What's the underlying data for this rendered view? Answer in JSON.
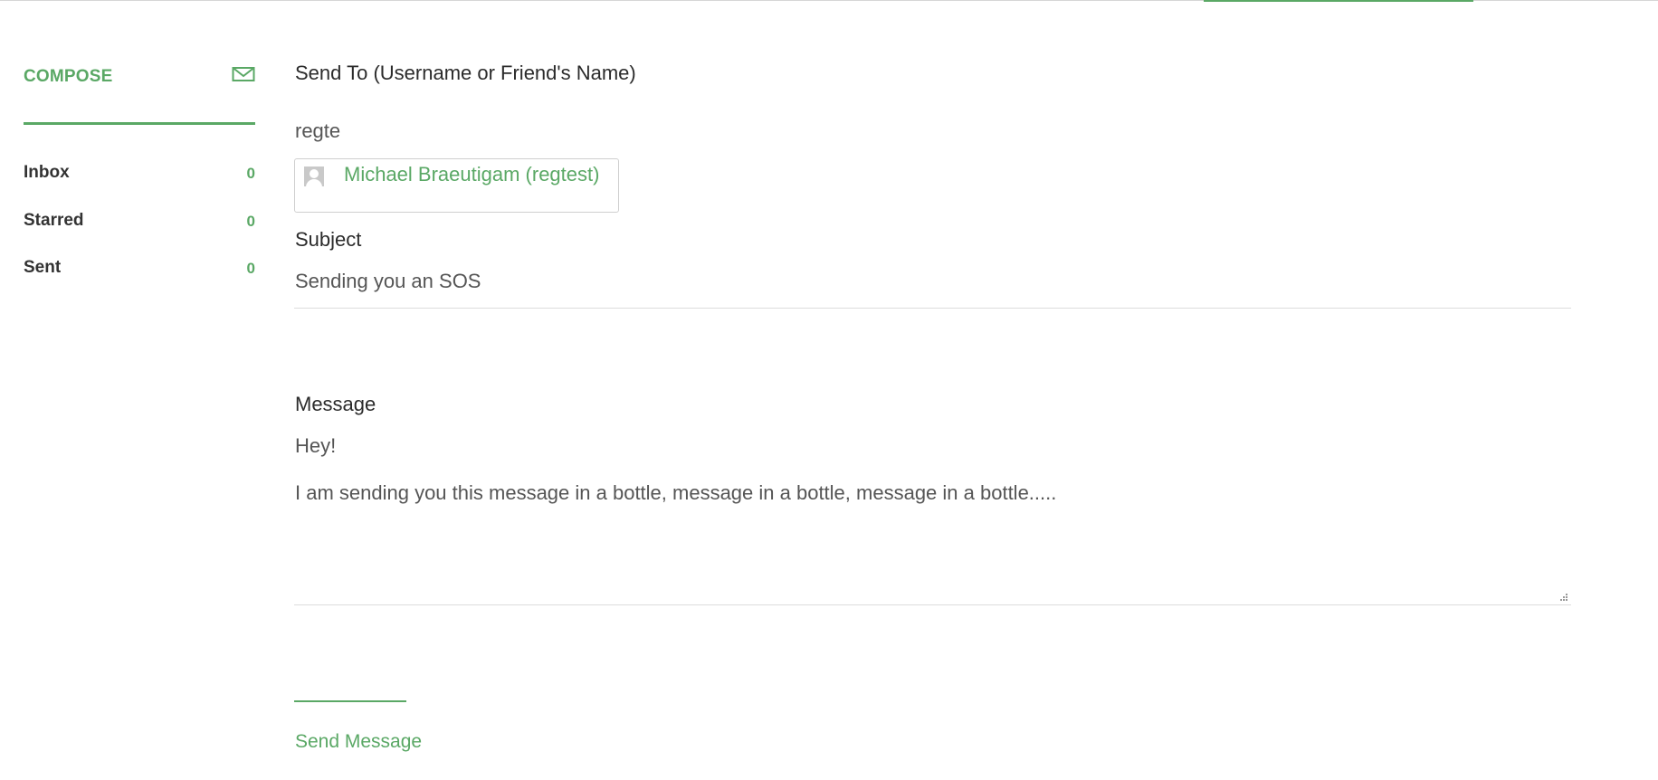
{
  "sidebar": {
    "compose_label": "COMPOSE",
    "compose_icon": "envelope-icon",
    "items": [
      {
        "label": "Inbox",
        "count": "0"
      },
      {
        "label": "Starred",
        "count": "0"
      },
      {
        "label": "Sent",
        "count": "0"
      }
    ]
  },
  "form": {
    "send_to_label": "Send To (Username or Friend's Name)",
    "send_to_value": "regte",
    "suggestion": {
      "avatar_icon": "user-avatar-icon",
      "text": "Michael Braeutigam (regtest)"
    },
    "subject_label": "Subject",
    "subject_value": "Sending you an SOS",
    "message_label": "Message",
    "message_value": "Hey!\n\nI am sending you this message in a bottle, message in a bottle, message in a bottle.....",
    "send_label": "Send Message"
  },
  "colors": {
    "accent": "#5aa865",
    "text": "#2b2b2b",
    "muted_text": "#555555",
    "border": "#dcdcdc"
  }
}
